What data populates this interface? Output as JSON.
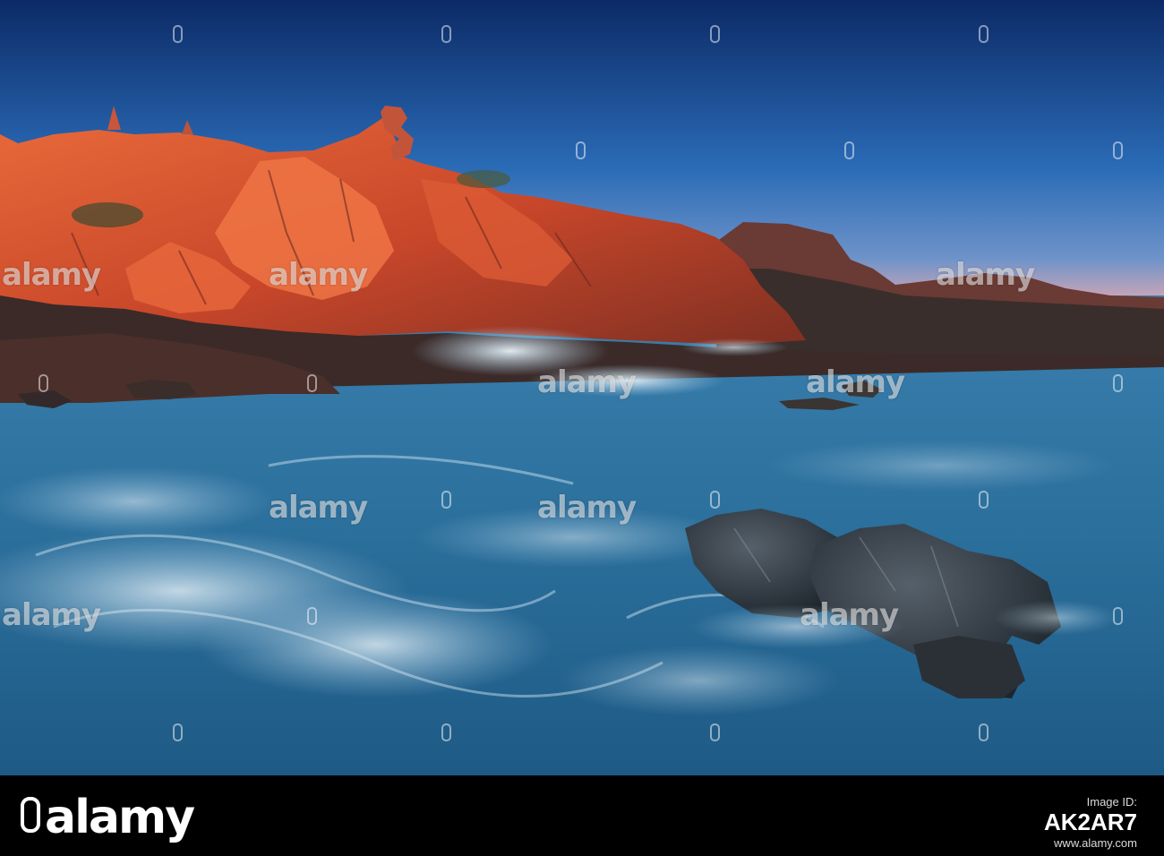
{
  "watermark": {
    "text": "alamy"
  },
  "footer": {
    "logo_text": "alamy",
    "stock_label": "Image ID:",
    "stock_id": "AK2AR7",
    "site": "www.alamy.com"
  },
  "colors": {
    "sky_top": "#0d2f6e",
    "sky_horizon": "#e6a6a6",
    "rock_lit": "#d2542e",
    "rock_shadow": "#2c2420",
    "sea": "#2f6f9a",
    "foam": "#cfe3ef",
    "footer_bg": "#000000"
  }
}
